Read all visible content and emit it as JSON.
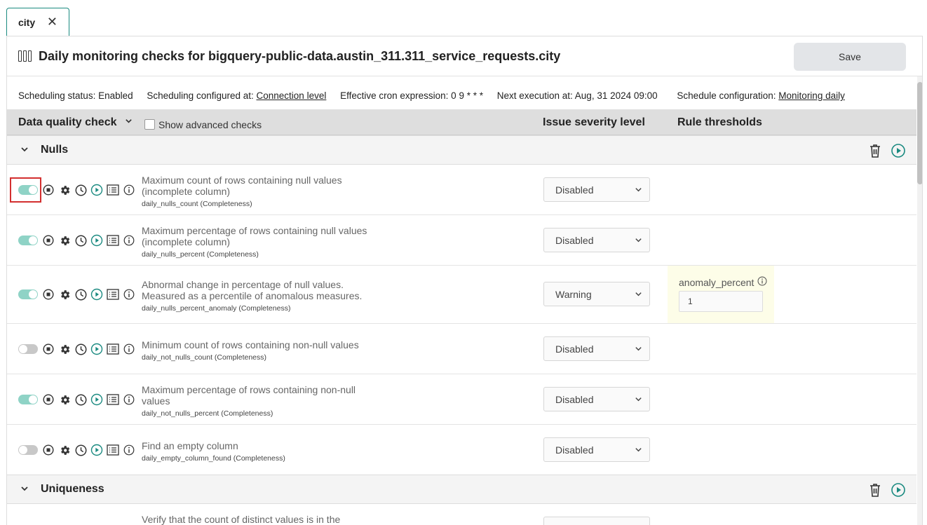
{
  "tabs": [
    {
      "label": "city",
      "close_icon": "close-icon"
    }
  ],
  "header": {
    "icon": "table-columns-icon",
    "title": "Daily monitoring checks for bigquery-public-data.austin_311.311_service_requests.city",
    "save_label": "Save"
  },
  "schedule": {
    "status_label": "Scheduling status: Enabled",
    "configured_label": "Scheduling configured at:",
    "configured_link": "Connection level",
    "cron_label": "Effective cron expression: 0 9 * * *",
    "next_label": "Next execution at: Aug, 31 2024 09:00",
    "config_label": "Schedule configuration:",
    "config_link": "Monitoring daily"
  },
  "columns": {
    "check": "Data quality check",
    "show_advanced": "Show advanced checks",
    "severity": "Issue severity level",
    "rules": "Rule thresholds"
  },
  "groups": [
    {
      "title": "Nulls",
      "checks": [
        {
          "enabled": true,
          "title_line1": "Maximum count of rows containing null values",
          "title_line2": "(incomplete column)",
          "code": "daily_nulls_count (Completeness)",
          "severity": "Disabled"
        },
        {
          "enabled": true,
          "title_line1": "Maximum percentage of rows containing null values",
          "title_line2": "(incomplete column)",
          "code": "daily_nulls_percent (Completeness)",
          "severity": "Disabled"
        },
        {
          "enabled": true,
          "title_line1": "Abnormal change in percentage of null values.",
          "title_line2": "Measured as a percentile of anomalous measures.",
          "code": "daily_nulls_percent_anomaly (Completeness)",
          "severity": "Warning",
          "rule": {
            "label": "anomaly_percent",
            "value": "1"
          }
        },
        {
          "enabled": false,
          "title_line1": "Minimum count of rows containing non-null values",
          "title_line2": "",
          "code": "daily_not_nulls_count (Completeness)",
          "severity": "Disabled"
        },
        {
          "enabled": true,
          "title_line1": "Maximum percentage of rows containing non-null",
          "title_line2": "values",
          "code": "daily_not_nulls_percent (Completeness)",
          "severity": "Disabled"
        },
        {
          "enabled": false,
          "title_line1": "Find an empty column",
          "title_line2": "",
          "code": "daily_empty_column_found (Completeness)",
          "severity": "Disabled"
        }
      ]
    },
    {
      "title": "Uniqueness",
      "checks": [
        {
          "enabled": true,
          "title_line1": "Verify that the count of distinct values is in the",
          "title_line2": "",
          "code": "",
          "severity": ""
        }
      ]
    }
  ],
  "colors": {
    "accent": "#1a8a80",
    "toggle_on": "#8fd3c6",
    "toggle_off": "#c8c8c8",
    "highlight": "#d32f2f",
    "rule_bg": "#fdfde8"
  }
}
